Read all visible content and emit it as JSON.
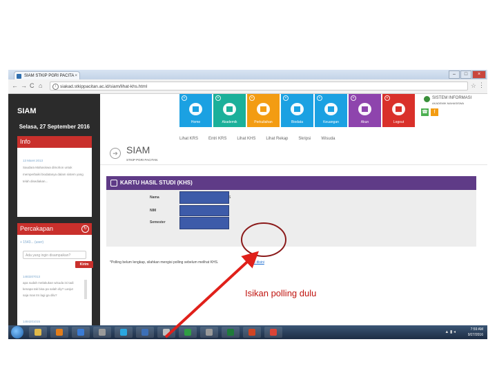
{
  "browser": {
    "tab_title": "SIAM STKIP PGRI PACITA",
    "tab_close": "×",
    "window_buttons": [
      "–",
      "□",
      "×"
    ],
    "nav": {
      "back": "←",
      "forward": "→",
      "reload": "C",
      "home": "⌂"
    },
    "url": "siakad.stkippacitan.ac.id/siam/lihat-khs.html",
    "star": "☆",
    "menu": "⋮"
  },
  "sidebar": {
    "logo": "SIAM",
    "date": "Selasa, 27 September 2016",
    "info": {
      "title": "Info",
      "date": "13 Maret 2013",
      "text": "Saudara Mahasiswa dimohon untuk memperbaiki biodatanya dalam sistem yang telah disediakan..."
    },
    "chat": {
      "title": "Percakapan",
      "user": "+ 1543... (user)",
      "input_placeholder": "Ada yang ingin disampaikan?",
      "send_label": "Kirim",
      "messages": [
        {
          "id": "1483207013",
          "text": "apa sudah melakukan wisuda ini tadi kenapa tak bisa pa salah diy? Lanjut saja mas trs lagi ga dilu?"
        },
        {
          "id": "1484201015",
          "text": ""
        }
      ]
    }
  },
  "top_menu": {
    "tiles": [
      {
        "label": "Home",
        "color": "#1ba1e2",
        "icon": "monitor-icon"
      },
      {
        "label": "Akademik",
        "color": "#1bb09a",
        "icon": "graduation-icon"
      },
      {
        "label": "Perkuliahan",
        "color": "#f39c12",
        "icon": "pencil-icon"
      },
      {
        "label": "Biodata",
        "color": "#1ba1e2",
        "icon": "chart-icon"
      },
      {
        "label": "Keuangan",
        "color": "#1ba1e2",
        "icon": "chart-icon"
      },
      {
        "label": "Akun",
        "color": "#8e44ad",
        "icon": "gear-icon"
      },
      {
        "label": "Logout",
        "color": "#d9302a",
        "icon": "lock-icon"
      }
    ],
    "system_info": {
      "title": "SISTEM INFORMASI",
      "subtitle": "AKADEMIK MAHASISWA"
    },
    "socials": [
      {
        "label": "☎",
        "color": "#4caf50"
      },
      {
        "label": "f",
        "color": "#f39c12"
      }
    ]
  },
  "subnav": [
    "Lihat KRS",
    "Entri KRS",
    "Lihat KHS",
    "Lihat Rekap",
    "Skripsi",
    "Wisuda"
  ],
  "header": {
    "title": "SIAM",
    "subtitle": "STKIP PGRI PACITAN"
  },
  "khs": {
    "title": "KARTU HASIL STUDI (KHS)",
    "fields": [
      {
        "label": "Nama"
      },
      {
        "label": "NIM"
      },
      {
        "label": "Semester"
      }
    ],
    "name_suffix": "S",
    "polling_text": "*Polling belum lengkap, silahkan mengisi polling sebelum melihat KHS.",
    "polling_link": "Klik disini"
  },
  "taskbar": {
    "time": "7:59 AM",
    "date": "9/27/2016",
    "apps": [
      {
        "icon": "folder-icon",
        "color": "#e0b94a"
      },
      {
        "icon": "media-icon",
        "color": "#e27d1a"
      },
      {
        "icon": "network-icon",
        "color": "#3a7bd5"
      },
      {
        "icon": "box-icon",
        "color": "#9a9a9a"
      },
      {
        "icon": "skype-icon",
        "color": "#2aa7e0"
      },
      {
        "icon": "app-icon",
        "color": "#3c6fb6"
      },
      {
        "icon": "paint-icon",
        "color": "#c0c0c0"
      },
      {
        "icon": "chrome-icon",
        "color": "#2f9e44"
      },
      {
        "icon": "tool-icon",
        "color": "#999999"
      },
      {
        "icon": "excel-icon",
        "color": "#1e7b3a"
      },
      {
        "icon": "powerpoint-icon",
        "color": "#d04423"
      },
      {
        "icon": "chrome-icon",
        "color": "#db4437"
      }
    ]
  },
  "annotation": {
    "text": "Isikan polling dulu",
    "color": "#e0201a"
  }
}
